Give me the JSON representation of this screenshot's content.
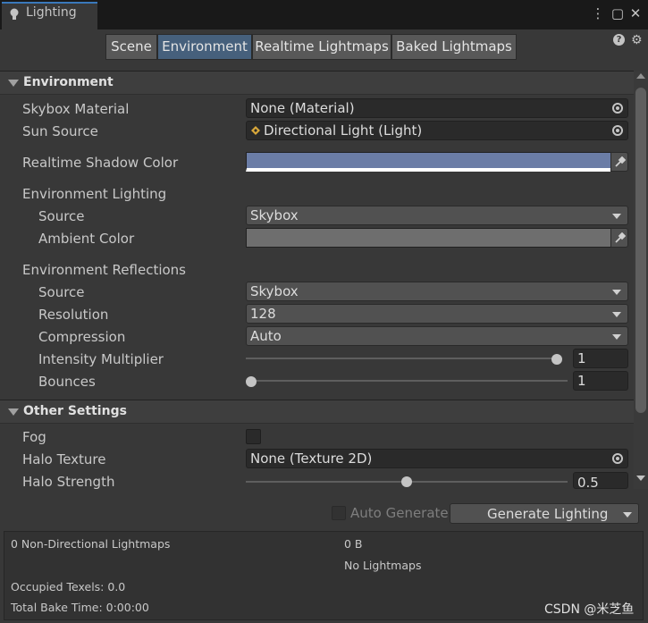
{
  "window": {
    "title": "Lighting",
    "menu_icon": "⋮",
    "maximize_icon": "▢",
    "close_icon": "✕"
  },
  "toolbar": {
    "tabs": [
      {
        "label": "Scene",
        "active": false
      },
      {
        "label": "Environment",
        "active": true
      },
      {
        "label": "Realtime Lightmaps",
        "active": false
      },
      {
        "label": "Baked Lightmaps",
        "active": false
      }
    ],
    "help_icon": "?",
    "gear_icon": "⚙"
  },
  "environment": {
    "title": "Environment",
    "skybox_material": {
      "label": "Skybox Material",
      "value": "None (Material)"
    },
    "sun_source": {
      "label": "Sun Source",
      "value": "Directional Light (Light)"
    },
    "realtime_shadow_color": {
      "label": "Realtime Shadow Color",
      "color": "#6b7da6"
    },
    "env_lighting": {
      "label": "Environment Lighting",
      "source": {
        "label": "Source",
        "value": "Skybox"
      },
      "ambient_color": {
        "label": "Ambient Color",
        "color": "#6e6e6e"
      }
    },
    "env_reflections": {
      "label": "Environment Reflections",
      "source": {
        "label": "Source",
        "value": "Skybox"
      },
      "resolution": {
        "label": "Resolution",
        "value": "128"
      },
      "compression": {
        "label": "Compression",
        "value": "Auto"
      },
      "intensity_multiplier": {
        "label": "Intensity Multiplier",
        "value": "1",
        "fraction": 1.0
      },
      "bounces": {
        "label": "Bounces",
        "value": "1",
        "fraction": 0.0
      }
    }
  },
  "other_settings": {
    "title": "Other Settings",
    "fog": {
      "label": "Fog",
      "checked": false
    },
    "halo_texture": {
      "label": "Halo Texture",
      "value": "None (Texture 2D)"
    },
    "halo_strength": {
      "label": "Halo Strength",
      "value": "0.5",
      "fraction": 0.5
    }
  },
  "bottom": {
    "auto_generate": {
      "label": "Auto Generate",
      "checked": false
    },
    "generate_button": "Generate Lighting"
  },
  "stats": {
    "non_directional": "0 Non-Directional Lightmaps",
    "size": "0 B",
    "no_lightmaps": "No Lightmaps",
    "occupied_texels": "Occupied Texels: 0.0",
    "bake_time": "Total Bake Time: 0:00:00"
  },
  "watermark": "CSDN @米芝鱼"
}
